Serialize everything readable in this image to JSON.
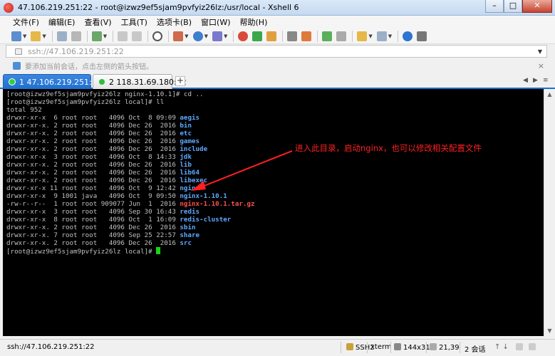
{
  "window": {
    "title": "47.106.219.251:22 - root@izwz9ef5sjam9pvfyiz26lz:/usr/local - Xshell 6",
    "buttons": {
      "minimize": "–",
      "maximize": "□",
      "close": "✕"
    }
  },
  "menubar": {
    "items": [
      "文件(F)",
      "编辑(E)",
      "查看(V)",
      "工具(T)",
      "选项卡(B)",
      "窗口(W)",
      "帮助(H)"
    ]
  },
  "address_bar": {
    "value": "ssh://47.106.219.251:22"
  },
  "hint_bar": {
    "text": "要添加当前会话，点击左侧的箭头按钮。",
    "close": "×"
  },
  "tabs": [
    {
      "label": "1 47.106.219.251:22",
      "active": true,
      "close": "×"
    },
    {
      "label": "2 118.31.69.180:22",
      "active": false,
      "close": "×"
    }
  ],
  "tab_add": "+",
  "terminal": {
    "lines": [
      {
        "text": "[root@izwz9ef5sjam9pvfyiz26lz nginx-1.10.1]# cd .."
      },
      {
        "text": "[root@izwz9ef5sjam9pvfyiz26lz local]# ll"
      },
      {
        "text": "total 952"
      },
      {
        "prefix": "drwxr-xr-x  6 root root   4096 Oct  8 09:09 ",
        "name": "aegis",
        "kind": "dir"
      },
      {
        "prefix": "drwxr-xr-x. 2 root root   4096 Dec 26  2016 ",
        "name": "bin",
        "kind": "dir"
      },
      {
        "prefix": "drwxr-xr-x. 2 root root   4096 Dec 26  2016 ",
        "name": "etc",
        "kind": "dir"
      },
      {
        "prefix": "drwxr-xr-x. 2 root root   4096 Dec 26  2016 ",
        "name": "games",
        "kind": "dir"
      },
      {
        "prefix": "drwxr-xr-x. 2 root root   4096 Dec 26  2016 ",
        "name": "include",
        "kind": "dir"
      },
      {
        "prefix": "drwxr-xr-x  3 root root   4096 Oct  8 14:33 ",
        "name": "jdk",
        "kind": "dir"
      },
      {
        "prefix": "drwxr-xr-x. 2 root root   4096 Dec 26  2016 ",
        "name": "lib",
        "kind": "dir"
      },
      {
        "prefix": "drwxr-xr-x. 2 root root   4096 Dec 26  2016 ",
        "name": "lib64",
        "kind": "dir"
      },
      {
        "prefix": "drwxr-xr-x. 2 root root   4096 Dec 26  2016 ",
        "name": "libexec",
        "kind": "dir"
      },
      {
        "prefix": "drwxr-xr-x 11 root root   4096 Oct  9 12:42 ",
        "name": "nginx",
        "kind": "dir"
      },
      {
        "prefix": "drwxr-xr-x  9 1001 java   4096 Oct  9 09:50 ",
        "name": "nginx-1.10.1",
        "kind": "dir"
      },
      {
        "prefix": "-rw-r--r--  1 root root 909077 Jun  1  2016 ",
        "name": "nginx-1.10.1.tar.gz",
        "kind": "archive"
      },
      {
        "prefix": "drwxr-xr-x  3 root root   4096 Sep 30 16:43 ",
        "name": "redis",
        "kind": "dir"
      },
      {
        "prefix": "drwxr-xr-x  8 root root   4096 Oct  1 16:09 ",
        "name": "redis-cluster",
        "kind": "dir"
      },
      {
        "prefix": "drwxr-xr-x. 2 root root   4096 Dec 26  2016 ",
        "name": "sbin",
        "kind": "dir"
      },
      {
        "prefix": "drwxr-xr-x. 7 root root   4096 Sep 25 22:57 ",
        "name": "share",
        "kind": "dir"
      },
      {
        "prefix": "drwxr-xr-x. 2 root root   4096 Dec 26  2016 ",
        "name": "src",
        "kind": "dir"
      },
      {
        "text": "[root@izwz9ef5sjam9pvfyiz26lz local]# ",
        "cursor": true
      }
    ]
  },
  "annotation": {
    "text": "进入此目录，启动nginx，也可以修改相关配置文件",
    "color": "#ff2020"
  },
  "statusbar": {
    "address": "ssh://47.106.219.251:22",
    "protocol": "SSH2",
    "terminal_type": "xterm",
    "size": "144x31",
    "cursor_pos": "21,39",
    "sessions": "2 会话"
  },
  "colors": {
    "accent": "#1f6fcf",
    "terminal_bg": "#000000",
    "dir": "#5fa8ff",
    "archive": "#ff5050",
    "cursor": "#16d616"
  }
}
